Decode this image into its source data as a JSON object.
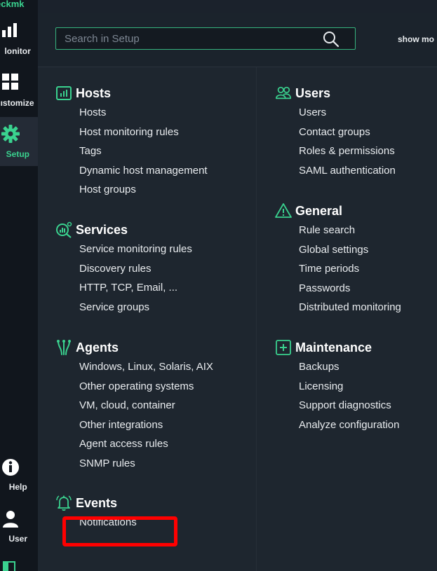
{
  "app": {
    "brand": "eckmk"
  },
  "nav": {
    "monitor": "lonitor",
    "customize": "ıstomize",
    "setup": "Setup",
    "help": "Help",
    "user": "User"
  },
  "search": {
    "placeholder": "Search in Setup",
    "show_more": "show mo"
  },
  "colors": {
    "accent": "#3ad28f",
    "highlight": "#ff0000"
  },
  "sections": {
    "hosts": {
      "title": "Hosts",
      "icon": "hosts-icon",
      "items": [
        "Hosts",
        "Host monitoring rules",
        "Tags",
        "Dynamic host management",
        "Host groups"
      ]
    },
    "services": {
      "title": "Services",
      "icon": "services-icon",
      "items": [
        "Service monitoring rules",
        "Discovery rules",
        "HTTP, TCP, Email, ...",
        "Service groups"
      ]
    },
    "agents": {
      "title": "Agents",
      "icon": "agents-icon",
      "items": [
        "Windows, Linux, Solaris, AIX",
        "Other operating systems",
        "VM, cloud, container",
        "Other integrations",
        "Agent access rules",
        "SNMP rules"
      ]
    },
    "events": {
      "title": "Events",
      "icon": "bell-icon",
      "items": [
        "Notifications"
      ]
    },
    "users": {
      "title": "Users",
      "icon": "users-icon",
      "items": [
        "Users",
        "Contact groups",
        "Roles & permissions",
        "SAML authentication"
      ]
    },
    "general": {
      "title": "General",
      "icon": "warning-icon",
      "items": [
        "Rule search",
        "Global settings",
        "Time periods",
        "Passwords",
        "Distributed monitoring"
      ]
    },
    "maintenance": {
      "title": "Maintenance",
      "icon": "plus-box-icon",
      "items": [
        "Backups",
        "Licensing",
        "Support diagnostics",
        "Analyze configuration"
      ]
    }
  }
}
